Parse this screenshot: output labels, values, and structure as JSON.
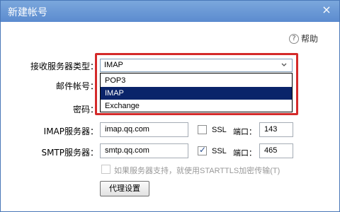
{
  "window": {
    "title": "新建帐号"
  },
  "help": {
    "icon": "?",
    "label": "帮助"
  },
  "form": {
    "server_type": {
      "label": "接收服务器类型：",
      "value": "IMAP",
      "options": [
        "POP3",
        "IMAP",
        "Exchange"
      ],
      "selected_index": 1
    },
    "email_label": "邮件帐号：",
    "password_label": "密码：",
    "imap": {
      "label": "IMAP服务器：",
      "server": "imap.qq.com",
      "ssl_label": "SSL",
      "ssl_checked": false,
      "port_label": "端口：",
      "port": "143"
    },
    "smtp": {
      "label": "SMTP服务器：",
      "server": "smtp.qq.com",
      "ssl_label": "SSL",
      "ssl_checked": true,
      "port_label": "端口：",
      "port": "465"
    },
    "starttls": {
      "label": "如果服务器支持，就使用STARTTLS加密传输(T)",
      "checked": false,
      "enabled": false
    },
    "proxy_button": "代理设置"
  },
  "colors": {
    "titlebar": "#6b98d6",
    "highlight": "#d42a2a",
    "selection": "#0a246a"
  }
}
